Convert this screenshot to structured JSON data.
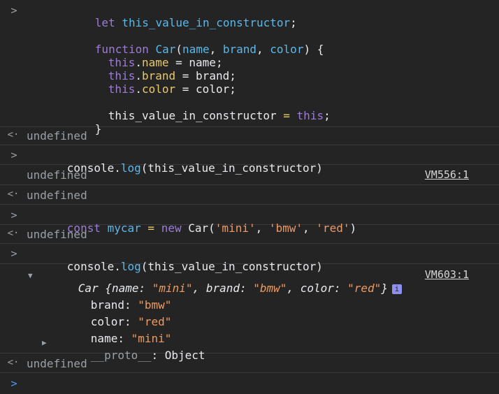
{
  "code_block": {
    "prompt_symbol": ">",
    "lines": [
      {
        "kw": "let",
        "var": "this_value_in_constructor",
        "end": ";"
      },
      {
        "kw": "function",
        "fn": "Car",
        "params": [
          {
            "n": "name"
          },
          {
            "n": "brand"
          },
          {
            "n": "color"
          }
        ],
        "end": ") {"
      },
      {
        "this": "this",
        "prop": "name",
        "val": "name;"
      },
      {
        "this": "this",
        "prop": "brand",
        "val": "brand;"
      },
      {
        "this": "this",
        "prop": "color",
        "val": "color;"
      },
      {
        "assign_left": "this_value_in_constructor",
        "eq": "=",
        "this": "this",
        "end": ";"
      },
      {
        "close": "}"
      }
    ]
  },
  "result_symbol": "<·",
  "undefined_text": "undefined",
  "log1": {
    "obj": "console",
    "method": "log",
    "arg": "this_value_in_constructor",
    "output": "undefined",
    "source": "VM556:1"
  },
  "const_line": {
    "kw": "const",
    "var": "mycar",
    "eq": "=",
    "new_kw": "new",
    "fn": "Car",
    "args": [
      "'mini'",
      "'bmw'",
      "'red'"
    ]
  },
  "log2": {
    "obj": "console",
    "method": "log",
    "arg": "this_value_in_constructor",
    "source": "VM603:1",
    "summary": {
      "ctor": "Car",
      "pairs": [
        {
          "k": "name",
          "v": "\"mini\""
        },
        {
          "k": "brand",
          "v": "\"bmw\""
        },
        {
          "k": "color",
          "v": "\"red\""
        }
      ],
      "badge": "i"
    },
    "props": [
      {
        "k": "brand",
        "v": "\"bmw\""
      },
      {
        "k": "color",
        "v": "\"red\""
      },
      {
        "k": "name",
        "v": "\"mini\""
      }
    ],
    "proto": {
      "k": "__proto__",
      "v": "Object"
    }
  },
  "colors": {
    "background": "#242424",
    "keyword": "#c586f0",
    "identifier": "#5ab8ea",
    "property": "#e8c96b",
    "string": "#ee9a63",
    "prompt_caret": "#4f9ef7"
  }
}
